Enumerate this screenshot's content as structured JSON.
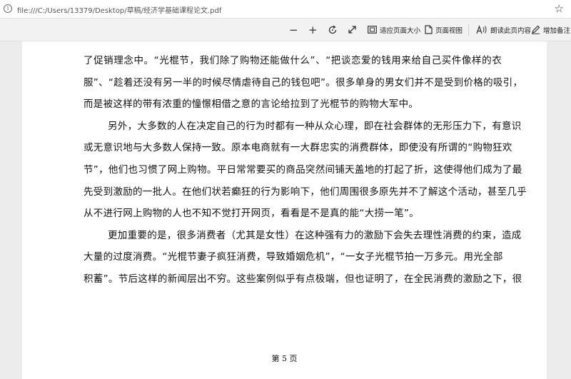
{
  "address_bar": {
    "url": "file:///C:/Users/13379/Desktop/草稿/经济学基础课程论文.pdf"
  },
  "toolbar": {
    "zoom_out_symbol": "−",
    "zoom_in_symbol": "+",
    "fit_page_label": "适应页面大小",
    "page_view_label": "页面视图",
    "read_aloud_label": "朗读此页内容",
    "add_notes_label": "增加备注"
  },
  "document": {
    "lines": [
      "了促销理念中。“光棍节，我们除了购物还能做什么”、“把谈恋爱的钱用来给自己买件像样的衣",
      "服”、“趁着还没有另一半的时候尽情虐待自己的钱包吧”。很多单身的男女们并不是受到价格的吸引，",
      "而是被这样的带有浓重的憧憬相借之意的言论给拉到了光棍节的购物大军中。",
      "另外，大多数的人在决定自己的行为时都有一种从众心理，即在社会群体的无形压力下，有意识",
      "或无意识地与大多数人保持一致。原本电商就有一大群忠实的消费群体，即使没有所谓的“购物狂欢",
      "节”，他们也习惯了网上购物。平日常常要买的商品突然间铺天盖地的打起了折，这使得他们成为了最",
      "先受到激励的一批人。在他们状若癫狂的行为影响下，他们周围很多原先并不了解这个活动，甚至几乎",
      "从不进行网上购物的人也不知不觉打开网页，看看是不是真的能“大捞一笔”。",
      "更加重要的是，很多消费者（尤其是女性）在这种强有力的激励下会失去理性消费的约束，造成",
      "大量的过度消费。“光棍节妻子疯狂消费，导致婚姻危机”，“一女子光棍节拍一万多元。用光全部",
      "积蓄”。节后这样的新闻层出不穷。这些案例似乎有点极端，但也证明了，在全民消费的激励之下，很"
    ],
    "page_label": "第 5 页"
  }
}
